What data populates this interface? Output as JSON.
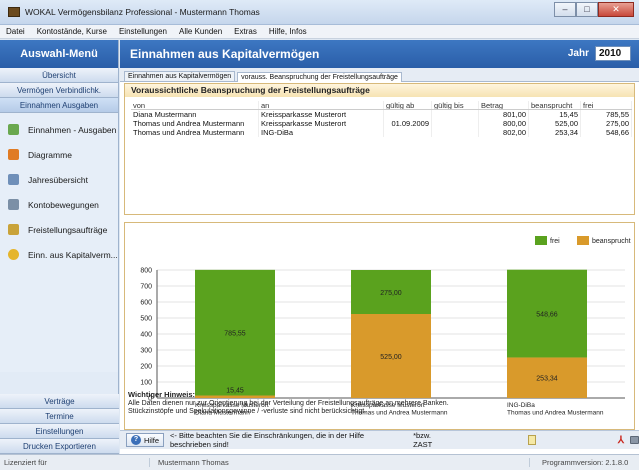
{
  "window": {
    "title": "WOKAL Vermögensbilanz Professional  -  Mustermann Thomas"
  },
  "menu": [
    "Datei",
    "Kontostände, Kurse",
    "Einstellungen",
    "Alle Kunden",
    "Extras",
    "Hilfe, Infos"
  ],
  "sidebar": {
    "header": "Auswahl-Menü",
    "top_buttons": [
      "Übersicht",
      "Vermögen Verbindlichk.",
      "Einnahmen Ausgaben"
    ],
    "items": [
      {
        "label": "Einnahmen - Ausgaben",
        "icon": "coins-icon",
        "color": "#6aa84f"
      },
      {
        "label": "Diagramme",
        "icon": "bar-chart-icon",
        "color": "#e07b24"
      },
      {
        "label": "Jahresübersicht",
        "icon": "calendar-icon",
        "color": "#6f8fb9"
      },
      {
        "label": "Kontobewegungen",
        "icon": "list-icon",
        "color": "#7b8fa6"
      },
      {
        "label": "Freistellungsaufträge",
        "icon": "document-pen-icon",
        "color": "#c9a33a"
      },
      {
        "label": "Einn. aus Kapitalverm...",
        "icon": "money-bag-icon",
        "color": "#e5b52c"
      }
    ],
    "bottom_buttons": [
      "Verträge",
      "Termine",
      "Einstellungen",
      "Drucken  Exportieren"
    ]
  },
  "main": {
    "title": "Einnahmen aus Kapitalvermögen",
    "year_label": "Jahr",
    "year_value": "2010",
    "tabs": [
      "Einnahmen aus Kapitalvermögen",
      "vorauss. Beanspruchung der Freistellungsaufträge"
    ]
  },
  "table": {
    "title": "Voraussichtliche Beanspruchung der Freistellungsaufträge",
    "columns": [
      "von",
      "an",
      "gültig ab",
      "gültig bis",
      "Betrag",
      "beansprucht",
      "frei"
    ],
    "rows": [
      [
        "Diana Mustermann",
        "Kreissparkasse Musterort",
        "",
        "",
        "801,00",
        "15,45",
        "785,55"
      ],
      [
        "Thomas und Andrea Mustermann",
        "Kreissparkasse Musterort",
        "01.09.2009",
        "",
        "800,00",
        "525,00",
        "275,00"
      ],
      [
        "Thomas und Andrea Mustermann",
        "ING-DiBa",
        "",
        "",
        "802,00",
        "253,34",
        "548,66"
      ]
    ]
  },
  "chart_data": {
    "type": "bar",
    "stacked": true,
    "categories": [
      [
        "Kreissparkasse Musterort",
        "Diana Mustermann"
      ],
      [
        "Kreissparkasse Musterort",
        "Thomas und Andrea Mustermann"
      ],
      [
        "ING-DiBa",
        "Thomas und Andrea Mustermann"
      ]
    ],
    "series": [
      {
        "name": "beansprucht",
        "values": [
          15.45,
          525.0,
          253.34
        ],
        "color": "#d99a2b"
      },
      {
        "name": "frei",
        "values": [
          785.55,
          275.0,
          548.66
        ],
        "color": "#5aa21e"
      }
    ],
    "value_labels": {
      "beansprucht": [
        "15,45",
        "525,00",
        "253,34"
      ],
      "frei": [
        "785,55",
        "275,00",
        "548,66"
      ]
    },
    "ylim": [
      0,
      800
    ],
    "yticks": [
      0,
      100,
      200,
      300,
      400,
      500,
      600,
      700,
      800
    ],
    "legend": [
      "frei",
      "beansprucht"
    ],
    "legend_position": "top-right",
    "grid": true
  },
  "hint": {
    "title": "Wichtiger Hinweis:",
    "lines": [
      "Alle Daten dienen nur zur Orientierung bei der Verteilung der Freistellungsaufträge an mehrere Banken.",
      "Stückzinstöpfe und Spekulationsgewinne / -verluste sind nicht berücksichtigt."
    ]
  },
  "helpbar": {
    "button": "Hilfe",
    "text": "<- Bitte beachten Sie die Einschränkungen, die in der Hilfe beschrieben sind!",
    "note": "*bzw. ZAST"
  },
  "status": {
    "license": "Lizenziert für",
    "user": "Mustermann Thomas",
    "version": "Programmversion: 2.1.8.0"
  }
}
